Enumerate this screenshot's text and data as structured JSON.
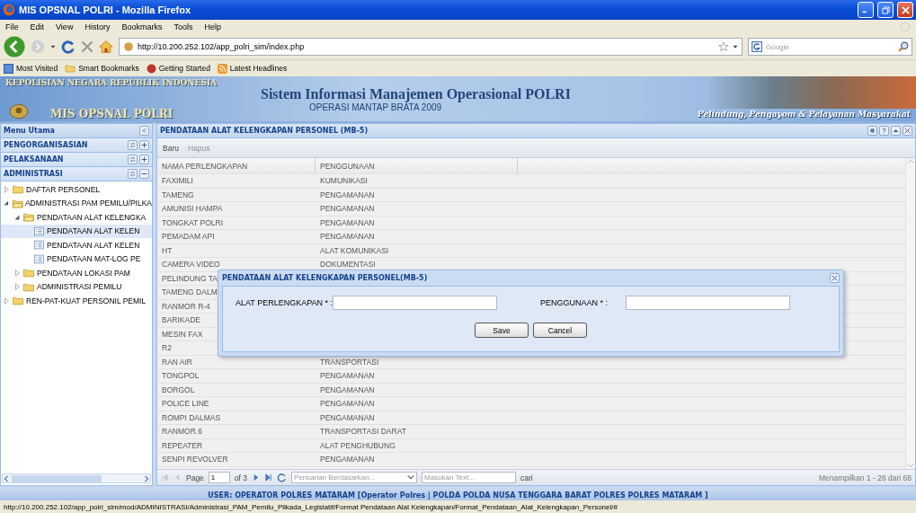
{
  "window": {
    "title": "MIS OPSNAL POLRI - Mozilla Firefox"
  },
  "menu": [
    "File",
    "Edit",
    "View",
    "History",
    "Bookmarks",
    "Tools",
    "Help"
  ],
  "address": {
    "value": "http://10.200.252.102/app_polri_sim/index.php"
  },
  "search": {
    "placeholder": "Google"
  },
  "bookmarks": [
    {
      "label": "Most Visited",
      "kind": "page"
    },
    {
      "label": "Smart Bookmarks",
      "kind": "folder"
    },
    {
      "label": "Getting Started",
      "kind": "start"
    },
    {
      "label": "Latest Headlines",
      "kind": "feed"
    }
  ],
  "banner": {
    "agency": "KEPOLISIAN NEGARA REPUBLIK INDONESIA",
    "app_name": "MIS OPSNAL POLRI",
    "title": "Sistem Informasi Manajemen Operasional POLRI",
    "subtitle": "OPERASI MANTAP BRATA 2009",
    "motto": "Pelindung, Pengayom & Pelayanan Masyarakat"
  },
  "sidebar": {
    "title": "Menu Utama",
    "sections": [
      {
        "label": "PENGORGANISASIAN",
        "expanded": false
      },
      {
        "label": "PELAKSANAAN",
        "expanded": false
      },
      {
        "label": "ADMINISTRASI",
        "expanded": true
      }
    ],
    "tree": [
      {
        "label": "DAFTAR PERSONEL",
        "kind": "folder",
        "expanded": false,
        "selected": false
      },
      {
        "label": "ADMINISTRASI PAM PEMILU/PILKA",
        "kind": "folder",
        "expanded": true,
        "selected": false,
        "children": [
          {
            "label": "PENDATAAN ALAT KELENGKA",
            "kind": "folder",
            "expanded": true,
            "selected": false,
            "children": [
              {
                "label": "PENDATAAN ALAT KELEN",
                "kind": "leaf",
                "selected": true
              },
              {
                "label": "PENDATAAN ALAT KELEN",
                "kind": "leaf",
                "selected": false
              },
              {
                "label": "PENDATAAN MAT-LOG PE",
                "kind": "leaf",
                "selected": false
              }
            ]
          },
          {
            "label": "PENDATAAN LOKASI PAM",
            "kind": "folder",
            "expanded": false,
            "selected": false
          },
          {
            "label": "ADMINISTRASI PEMILU",
            "kind": "folder",
            "expanded": false,
            "selected": false
          }
        ]
      },
      {
        "label": "REN-PAT-KUAT PERSONIL PEMIL",
        "kind": "folder",
        "expanded": false,
        "selected": false
      }
    ]
  },
  "panel": {
    "title": "PENDATAAN ALAT KELENGKAPAN PERSONEL (MB-5)",
    "toolbar": [
      {
        "label": "Baru",
        "disabled": false
      },
      {
        "label": "Hapus",
        "disabled": true
      }
    ],
    "columns": [
      "NAMA PERLENGKAPAN",
      "PENGGUNAAN"
    ],
    "rows": [
      {
        "name": "FAXIMILI",
        "usage": "KUMUNIKASI"
      },
      {
        "name": "TAMENG",
        "usage": "PENGAMANAN"
      },
      {
        "name": "AMUNISI HAMPA",
        "usage": "PENGAMANAN"
      },
      {
        "name": "TONGKAT POLRI",
        "usage": "PENGAMANAN"
      },
      {
        "name": "PEMADAM API",
        "usage": "PENGAMANAN"
      },
      {
        "name": "HT",
        "usage": "ALAT KOMUNIKASI"
      },
      {
        "name": "CAMERA VIDEO",
        "usage": "DOKUMENTASI"
      },
      {
        "name": "PELINDUNG TA"
      },
      {
        "name": "TAMENG DALM"
      },
      {
        "name": "RANMOR R-4"
      },
      {
        "name": "BARIKADE"
      },
      {
        "name": "MESIN FAX"
      },
      {
        "name": "R2"
      },
      {
        "name": "RAN AIR",
        "usage": "TRANSPORTASI"
      },
      {
        "name": "TONGPOL",
        "usage": "PENGAMANAN"
      },
      {
        "name": "BORGOL",
        "usage": "PENGAMANAN"
      },
      {
        "name": "POLICE LINE",
        "usage": "PENGAMANAN"
      },
      {
        "name": "ROMPI DALMAS",
        "usage": "PENGAMANAN"
      },
      {
        "name": "RANMOR.6",
        "usage": "TRANSPORTASI DARAT"
      },
      {
        "name": "REPEATER",
        "usage": "ALAT PENGHUBUNG"
      },
      {
        "name": "SENPI REVOLVER",
        "usage": "PENGAMANAN"
      }
    ],
    "paging": {
      "page_label": "Page",
      "page": "1",
      "of": "of 3",
      "filter_placeholder": "Pencarian Berdasarkan...",
      "text_placeholder": "Masukan Text...",
      "search_label": "cari",
      "summary": "Menampilkan 1 - 26 dari 68"
    }
  },
  "dialog": {
    "title": "PENDATAAN ALAT KELENGKAPAN PERSONEL(MB-5)",
    "fields": [
      {
        "label": "ALAT PERLENGKAPAN * :"
      },
      {
        "label": "PENGGUNAAN * :"
      }
    ],
    "buttons": [
      "Save",
      "Cancel"
    ]
  },
  "user_bar": "USER: OPERATOR POLRES MATARAM [Operator Polres | POLDA POLDA NUSA TENGGARA BARAT POLRES POLRES MATARAM ]",
  "status_bar": "http://10.200.252.102/app_polri_sim/mod/ADMINISTRASI/Administrasi_PAM_Pemilu_Pilkada_Legislatif/Format Pendataan Alat Kelengkapan/Format_Pendataan_Alat_Kelengkapan_Personel/#"
}
